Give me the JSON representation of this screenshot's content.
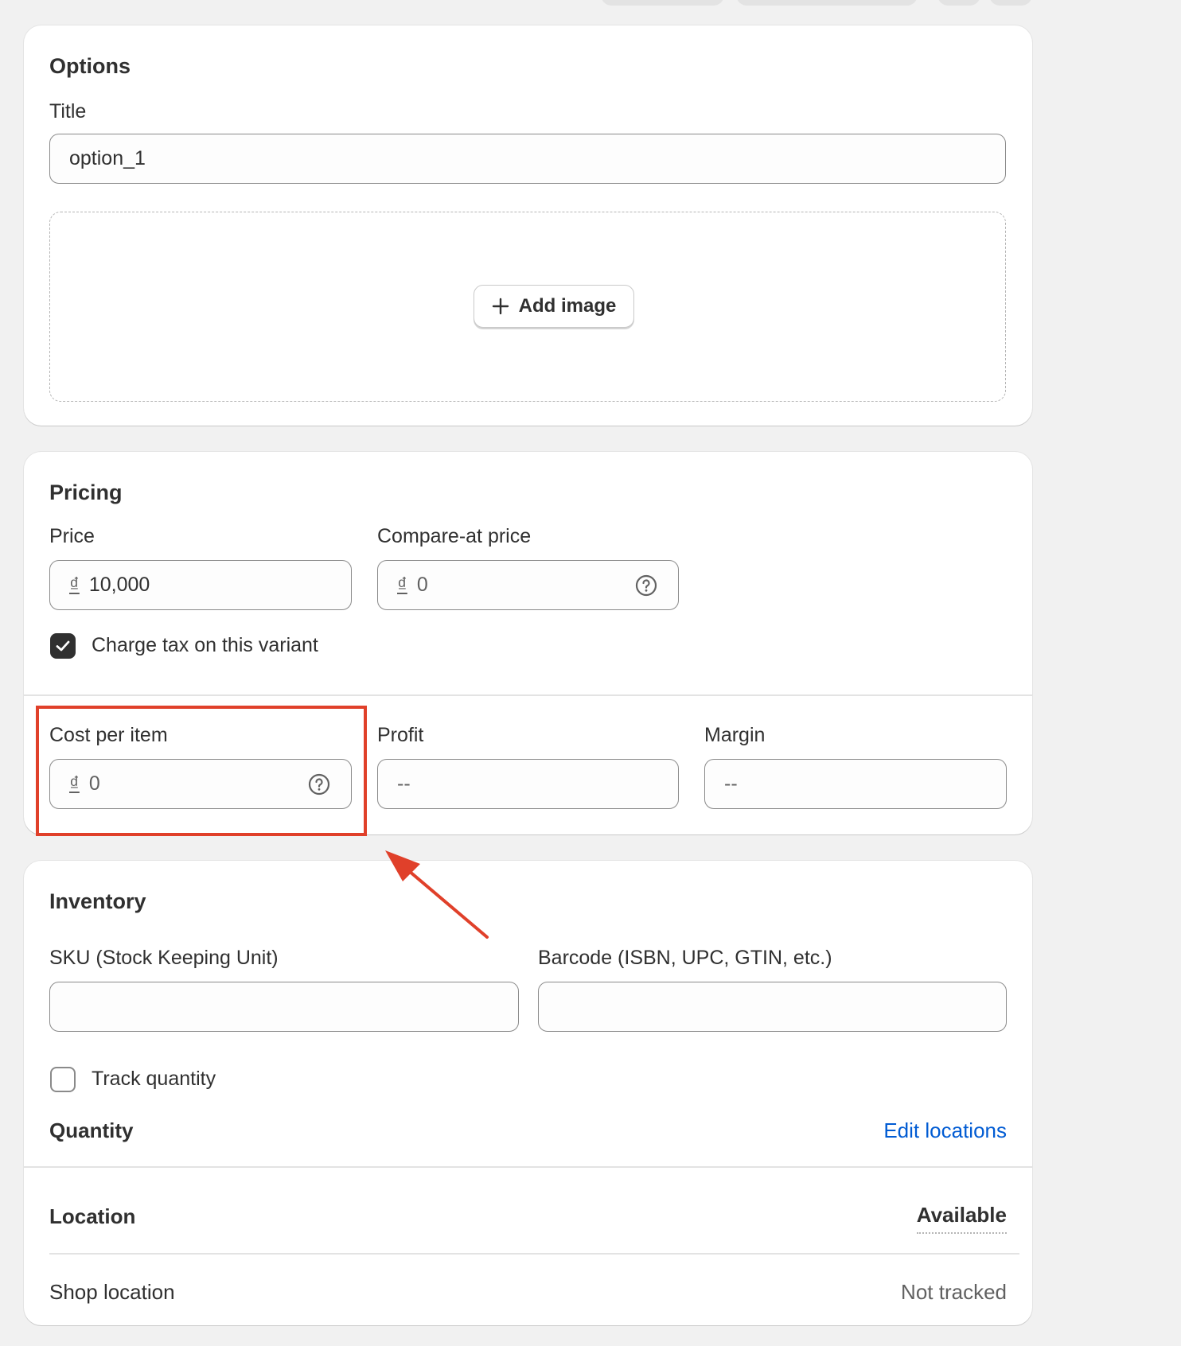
{
  "options": {
    "heading": "Options",
    "title_label": "Title",
    "title_value": "option_1",
    "add_image_label": "Add image"
  },
  "pricing": {
    "heading": "Pricing",
    "price_label": "Price",
    "price_currency": "₫",
    "price_value": "10,000",
    "compare_label": "Compare-at price",
    "compare_currency": "₫",
    "compare_value": "0",
    "charge_tax_label": "Charge tax on this variant",
    "charge_tax_checked": true,
    "cost_label": "Cost per item",
    "cost_currency": "₫",
    "cost_value": "0",
    "profit_label": "Profit",
    "profit_value": "--",
    "margin_label": "Margin",
    "margin_value": "--"
  },
  "inventory": {
    "heading": "Inventory",
    "sku_label": "SKU (Stock Keeping Unit)",
    "sku_value": "",
    "barcode_label": "Barcode (ISBN, UPC, GTIN, etc.)",
    "barcode_value": "",
    "track_quantity_label": "Track quantity",
    "track_quantity_checked": false,
    "quantity_heading": "Quantity",
    "edit_locations_label": "Edit locations",
    "location_header": "Location",
    "available_header": "Available",
    "rows": [
      {
        "location": "Shop location",
        "available": "Not tracked"
      }
    ]
  },
  "colors": {
    "accent_link": "#005bd3",
    "annotation_red": "#e0402a",
    "checkbox_dark": "#303030"
  },
  "icons": [
    "plus-icon",
    "help-circle-icon",
    "checkmark-icon",
    "annotation-arrow"
  ]
}
